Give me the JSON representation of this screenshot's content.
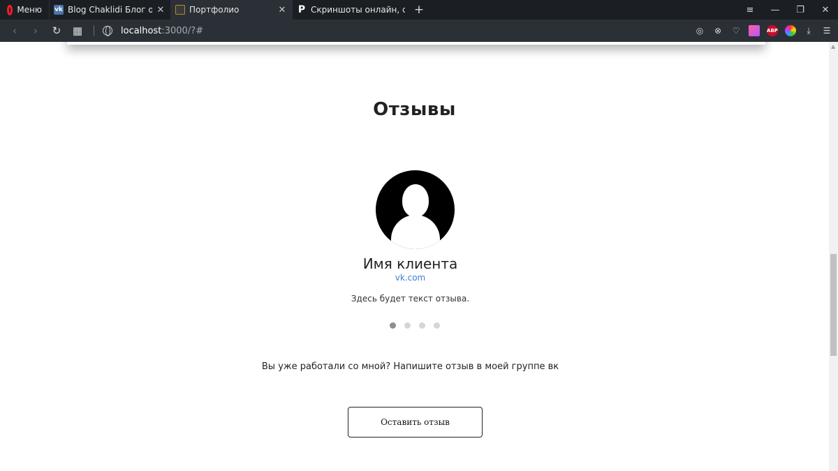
{
  "browser": {
    "menu_label": "Меню",
    "tabs": [
      {
        "title": "Blog Chaklidi Блог о web-р",
        "favicon": "vk-icon"
      },
      {
        "title": "Портфолио",
        "favicon": "folder-icon"
      },
      {
        "title": "Скриншоты онлайн, серви",
        "favicon": "p-icon"
      }
    ],
    "close_glyph": "✕",
    "newtab_glyph": "+",
    "url_host": "localhost",
    "url_rest": ":3000/?#"
  },
  "reviews": {
    "title": "Отзывы",
    "client_name": "Имя клиента",
    "client_link": "vk.com",
    "review_text": "Здесь будет текст отзыва.",
    "slides_total": 4,
    "active_slide": 1,
    "cta_text": "Вы уже работали со мной? Напишите отзыв в моей группе вк",
    "cta_button": "Оставить отзыв"
  }
}
